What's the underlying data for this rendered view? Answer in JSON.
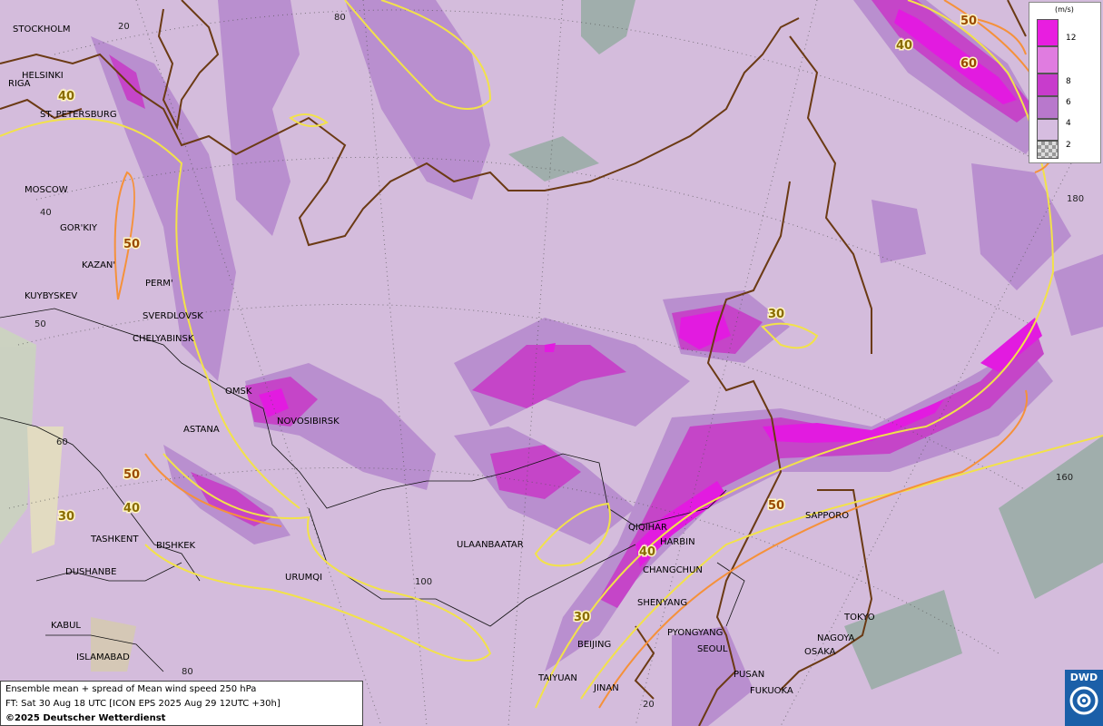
{
  "map": {
    "cities": [
      {
        "name": "STOCKHOLM"
      },
      {
        "name": "HELSINKI"
      },
      {
        "name": "RIGA"
      },
      {
        "name": "ST. PETERSBURG"
      },
      {
        "name": "MOSCOW"
      },
      {
        "name": "GOR'KIY"
      },
      {
        "name": "KAZAN'"
      },
      {
        "name": "PERM'"
      },
      {
        "name": "KUYBYSKEV"
      },
      {
        "name": "SVERDLOVSK"
      },
      {
        "name": "CHELYABINSK"
      },
      {
        "name": "OMSK"
      },
      {
        "name": "NOVOSIBIRSK"
      },
      {
        "name": "ASTANA"
      },
      {
        "name": "TASHKENT"
      },
      {
        "name": "BISHKEK"
      },
      {
        "name": "DUSHANBE"
      },
      {
        "name": "URUMQI"
      },
      {
        "name": "KABUL"
      },
      {
        "name": "ISLAMABAD"
      },
      {
        "name": "ULAANBAATAR"
      },
      {
        "name": "QIQIHAR"
      },
      {
        "name": "HARBIN"
      },
      {
        "name": "CHANGCHUN"
      },
      {
        "name": "SHENYANG"
      },
      {
        "name": "PYONGYANG"
      },
      {
        "name": "SEOUL"
      },
      {
        "name": "BEIJING"
      },
      {
        "name": "TAIYUAN"
      },
      {
        "name": "JINAN"
      },
      {
        "name": "PUSAN"
      },
      {
        "name": "FUKUOKA"
      },
      {
        "name": "SAPPORO"
      },
      {
        "name": "TOKYO"
      },
      {
        "name": "NAGOYA"
      },
      {
        "name": "OSAKA"
      }
    ],
    "grid_labels": [
      "20",
      "80",
      "40",
      "50",
      "60",
      "180",
      "160",
      "100",
      "80",
      "20"
    ],
    "isotach_labels": [
      "40",
      "40",
      "50",
      "50",
      "40",
      "30",
      "30",
      "40",
      "30",
      "50",
      "50",
      "40",
      "60"
    ]
  },
  "legend": {
    "unit": "(m/s)",
    "entries": [
      {
        "label": "12",
        "color": "#e81ee0"
      },
      {
        "label": "8",
        "color": "#c83ccc"
      },
      {
        "label": "6",
        "color": "#b878cc"
      },
      {
        "label": "4",
        "color": "#d6bde0"
      },
      {
        "label": "2",
        "color": "#f0ecf2"
      }
    ]
  },
  "info": {
    "line1": "Ensemble mean + spread of Mean wind speed 250 hPa",
    "line2": "FT: Sat 30 Aug 18 UTC [ICON EPS 2025 Aug 29 12UTC +30h]",
    "copyright": "©2025 Deutscher Wetterdienst"
  },
  "logo": {
    "text": "DWD"
  }
}
